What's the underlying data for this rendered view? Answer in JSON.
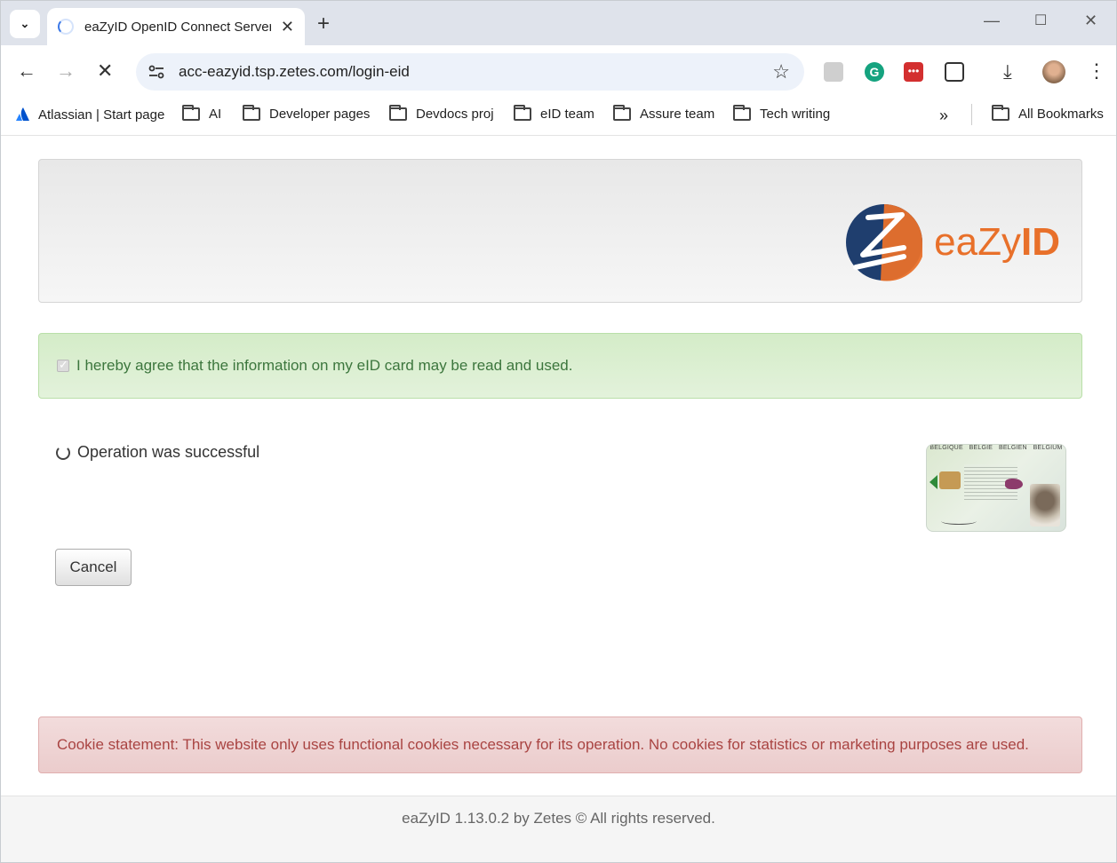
{
  "browser": {
    "tab_title": "eaZyID OpenID Connect Server",
    "url": "acc-eazyid.tsp.zetes.com/login-eid",
    "bookmarks": [
      {
        "label": "Atlassian | Start page",
        "icon": "atlassian-icon"
      },
      {
        "label": "AI",
        "icon": "folder-icon"
      },
      {
        "label": "Developer pages",
        "icon": "folder-icon"
      },
      {
        "label": "Devdocs proj",
        "icon": "folder-icon"
      },
      {
        "label": "eID team",
        "icon": "folder-icon"
      },
      {
        "label": "Assure team",
        "icon": "folder-icon"
      },
      {
        "label": "Tech writing",
        "icon": "folder-icon"
      }
    ],
    "all_bookmarks": "All Bookmarks",
    "accent_color": "#3b78e7"
  },
  "page": {
    "logo": {
      "prefix": "eaZy",
      "suffix": "ID",
      "color": "#e8702a",
      "circle_color": "#1f3e6e"
    },
    "agree_text": "I hereby agree that the information on my eID card may be read and used.",
    "agree_checked": true,
    "status_text": "Operation was successful",
    "cancel_label": "Cancel",
    "card_labels": [
      "BELGIQUE",
      "BELGIË",
      "BELGIEN",
      "BELGIUM"
    ],
    "cookie_text": "Cookie statement: This website only uses functional cookies necessary for its operation. No cookies for statistics or marketing purposes are used.",
    "footer_text": "eaZyID 1.13.0.2 by Zetes © All rights reserved."
  }
}
